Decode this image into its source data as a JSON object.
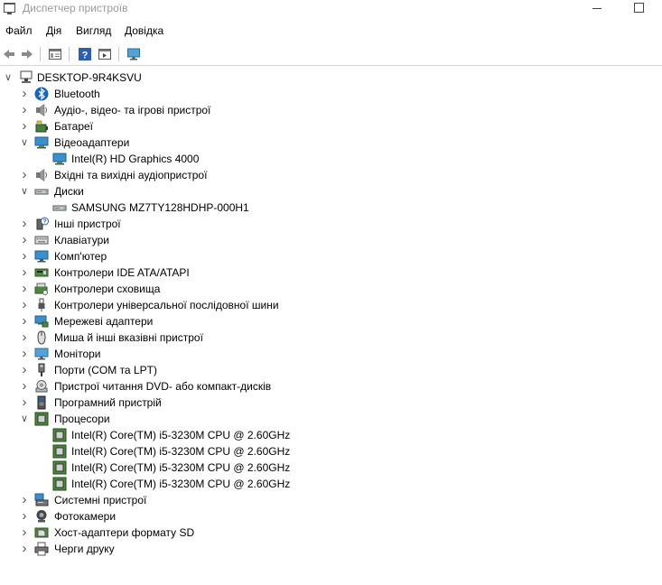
{
  "window": {
    "title": "Диспетчер пристроїв"
  },
  "menu": [
    "Файл",
    "Дія",
    "Вигляд",
    "Довідка"
  ],
  "toolbar": [
    "back-icon",
    "forward-icon",
    "properties-icon",
    "help-icon",
    "run-icon",
    "monitor-icon"
  ],
  "tree": {
    "root": "DESKTOP-9R4KSVU",
    "rows": [
      {
        "label": "Bluetooth",
        "icon": "bluetooth-icon",
        "expanded": false
      },
      {
        "label": "Аудіо-, відео- та ігрові пристрої",
        "icon": "speaker-icon",
        "expanded": false
      },
      {
        "label": "Батареї",
        "icon": "battery-icon",
        "expanded": false
      },
      {
        "label": "Відеоадаптери",
        "icon": "display-adapter-icon",
        "expanded": true
      },
      {
        "label": "Intel(R) HD Graphics 4000",
        "icon": "display-adapter-icon",
        "child": true
      },
      {
        "label": "Вхідні та вихідні аудіопристрої",
        "icon": "speaker-icon",
        "expanded": false
      },
      {
        "label": "Диски",
        "icon": "disk-icon",
        "expanded": true
      },
      {
        "label": "SAMSUNG MZ7TY128HDHP-000H1",
        "icon": "disk-icon",
        "child": true
      },
      {
        "label": "Інші пристрої",
        "icon": "unknown-device-icon",
        "expanded": false
      },
      {
        "label": "Клавіатури",
        "icon": "keyboard-icon",
        "expanded": false
      },
      {
        "label": "Комп'ютер",
        "icon": "computer-icon",
        "expanded": false
      },
      {
        "label": "Контролери IDE ATA/ATAPI",
        "icon": "ide-controller-icon",
        "expanded": false
      },
      {
        "label": "Контролери сховища",
        "icon": "storage-controller-icon",
        "expanded": false
      },
      {
        "label": "Контролери універсальної послідовної шини",
        "icon": "usb-icon",
        "expanded": false
      },
      {
        "label": "Мережеві адаптери",
        "icon": "network-adapter-icon",
        "expanded": false
      },
      {
        "label": "Миша й інші вказівні пристрої",
        "icon": "mouse-icon",
        "expanded": false
      },
      {
        "label": "Монітори",
        "icon": "monitor-icon",
        "expanded": false
      },
      {
        "label": "Порти (COM та LPT)",
        "icon": "port-icon",
        "expanded": false
      },
      {
        "label": "Пристрої читання DVD- або компакт-дисків",
        "icon": "dvd-icon",
        "expanded": false
      },
      {
        "label": "Програмний пристрій",
        "icon": "software-device-icon",
        "expanded": false
      },
      {
        "label": "Процесори",
        "icon": "processor-icon",
        "expanded": true
      },
      {
        "label": "Intel(R) Core(TM) i5-3230M CPU @ 2.60GHz",
        "icon": "processor-icon",
        "child": true
      },
      {
        "label": "Intel(R) Core(TM) i5-3230M CPU @ 2.60GHz",
        "icon": "processor-icon",
        "child": true
      },
      {
        "label": "Intel(R) Core(TM) i5-3230M CPU @ 2.60GHz",
        "icon": "processor-icon",
        "child": true
      },
      {
        "label": "Intel(R) Core(TM) i5-3230M CPU @ 2.60GHz",
        "icon": "processor-icon",
        "child": true
      },
      {
        "label": "Системні пристрої",
        "icon": "system-device-icon",
        "expanded": false
      },
      {
        "label": "Фотокамери",
        "icon": "camera-icon",
        "expanded": false
      },
      {
        "label": "Хост-адаптери формату SD",
        "icon": "sd-host-icon",
        "expanded": false
      },
      {
        "label": "Черги друку",
        "icon": "printer-icon",
        "expanded": false
      }
    ]
  }
}
